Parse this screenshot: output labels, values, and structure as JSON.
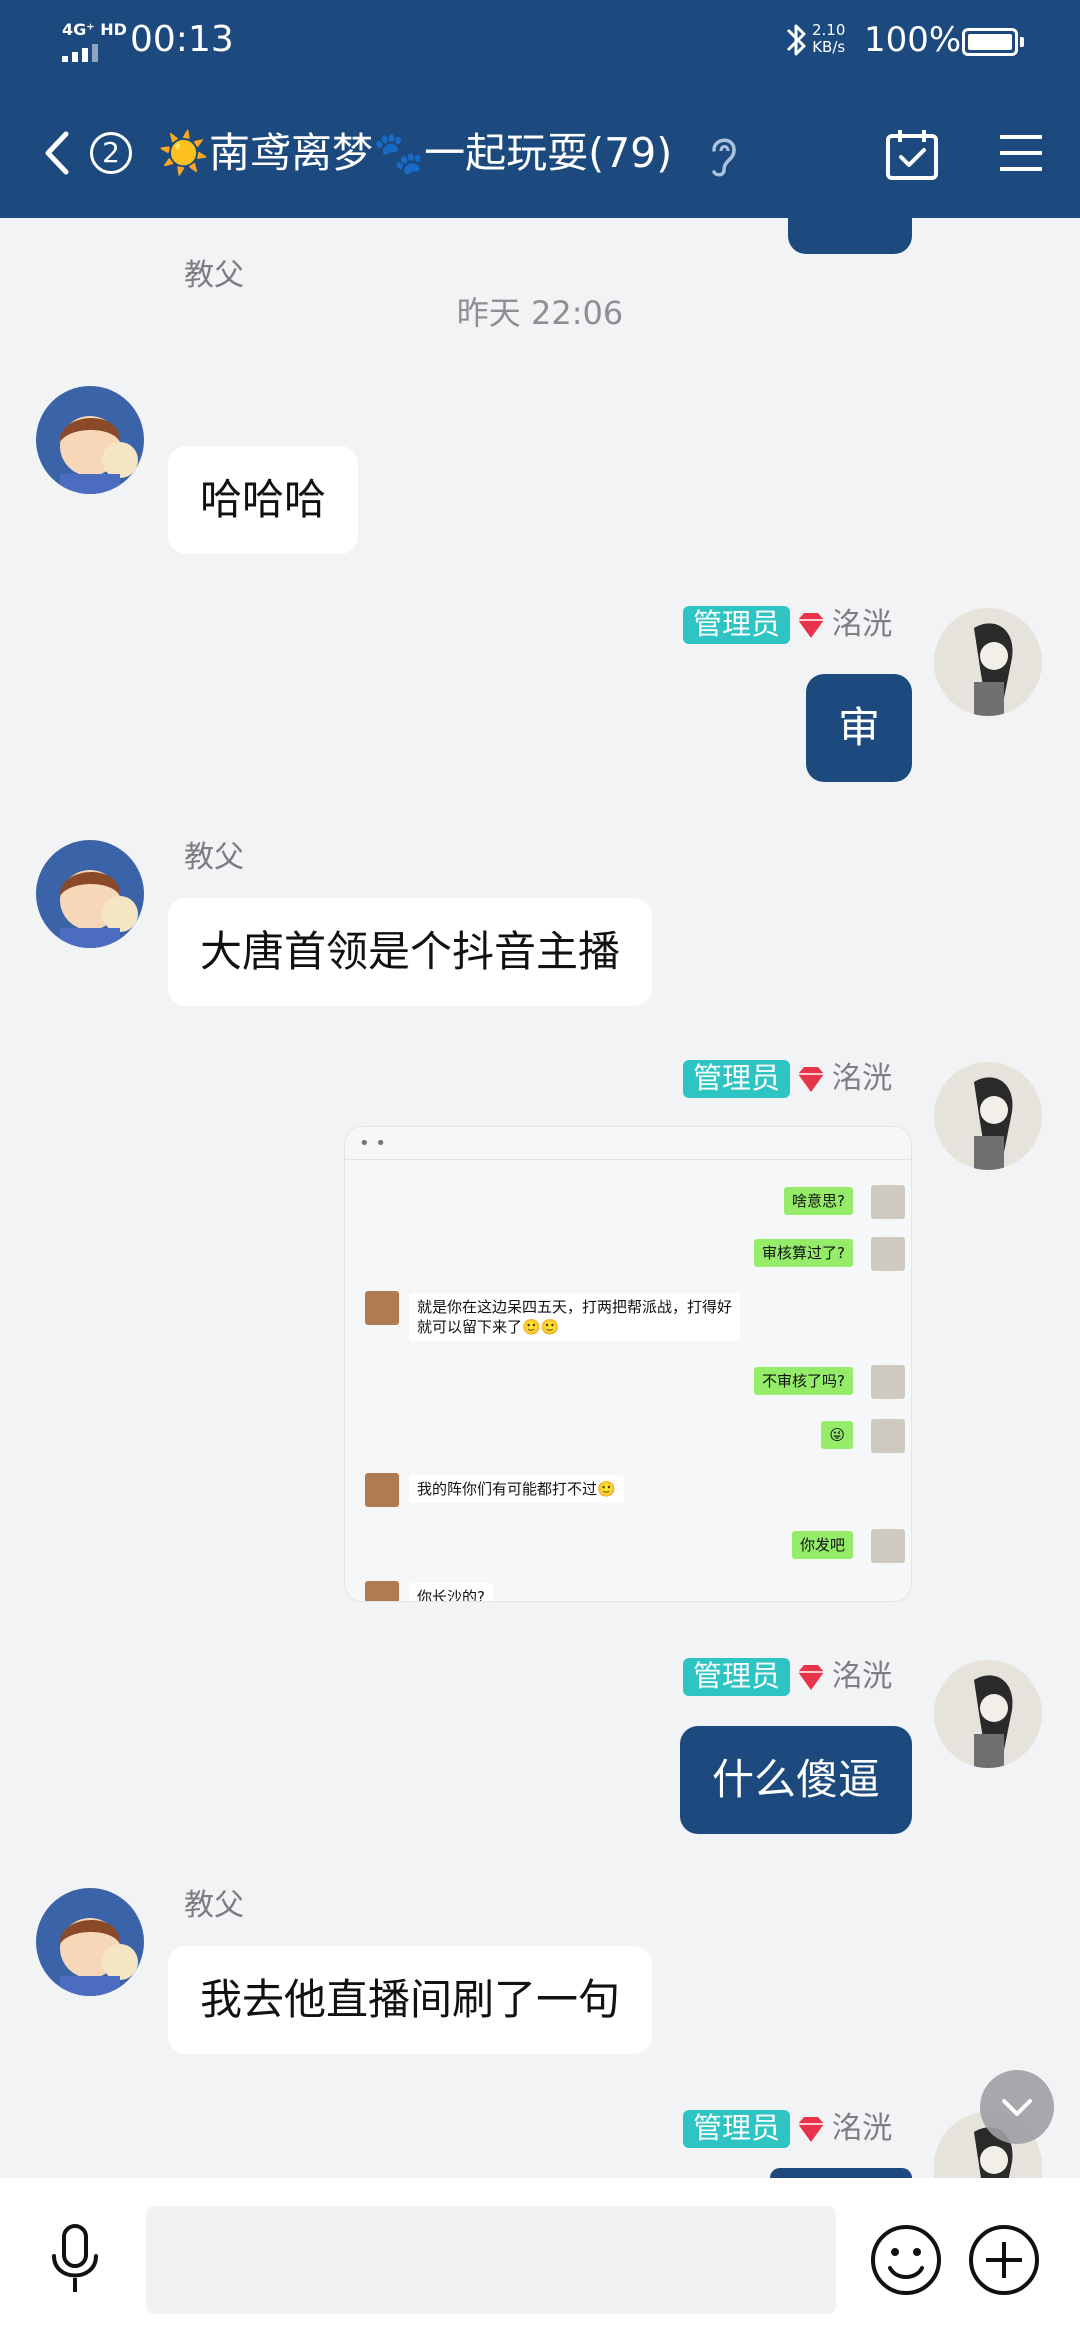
{
  "status_bar": {
    "network": "4G⁺ HD",
    "time": "00:13",
    "speed_value": "2.10",
    "speed_unit": "KB/s",
    "battery_percent": "100%",
    "battery_level": 1.0
  },
  "header": {
    "unread_count": "2",
    "group_title": "☀️南鸢离梦🐾一起玩耍(79)"
  },
  "chat": {
    "timestamp": "昨天 22:06",
    "messages": [
      {
        "side": "left",
        "sender": "教父",
        "text": "哈哈哈"
      },
      {
        "side": "right",
        "badge": "管理员",
        "sender": "洺洸",
        "text": "审"
      },
      {
        "side": "left",
        "sender": "教父",
        "text": "大唐首领是个抖音主播"
      },
      {
        "side": "right",
        "badge": "管理员",
        "sender": "洺洸",
        "type": "image",
        "image_lines": [
          "啥意思?",
          "审核算过了?",
          "就是你在这边呆四五天，打两把帮派战，打得好",
          "就可以留下来了🙂🙂",
          "不审核了吗?",
          "😜",
          "我的阵你们有可能都打不过🙂",
          "你发吧",
          "你长沙的?"
        ]
      },
      {
        "side": "right",
        "badge": "管理员",
        "sender": "洺洸",
        "text": "什么傻逼"
      },
      {
        "side": "left",
        "sender": "教父",
        "text": "我去他直播间刷了一句"
      },
      {
        "side": "right",
        "badge": "管理员",
        "sender": "洺洸",
        "text": ""
      }
    ]
  },
  "input": {
    "value": "",
    "placeholder": ""
  },
  "colors": {
    "header_bg": "#1c4a7e",
    "outgoing_bubble": "#1c4a7e",
    "incoming_bubble": "#ffffff",
    "admin_badge": "#2ec4c4",
    "chat_bg": "#f2f3f5"
  },
  "icons": [
    "back-arrow-icon",
    "bluetooth-icon",
    "battery-icon",
    "ear-icon",
    "calendar-check-icon",
    "menu-icon",
    "chevron-down-icon",
    "microphone-icon",
    "emoji-icon",
    "plus-icon",
    "gem-icon"
  ]
}
